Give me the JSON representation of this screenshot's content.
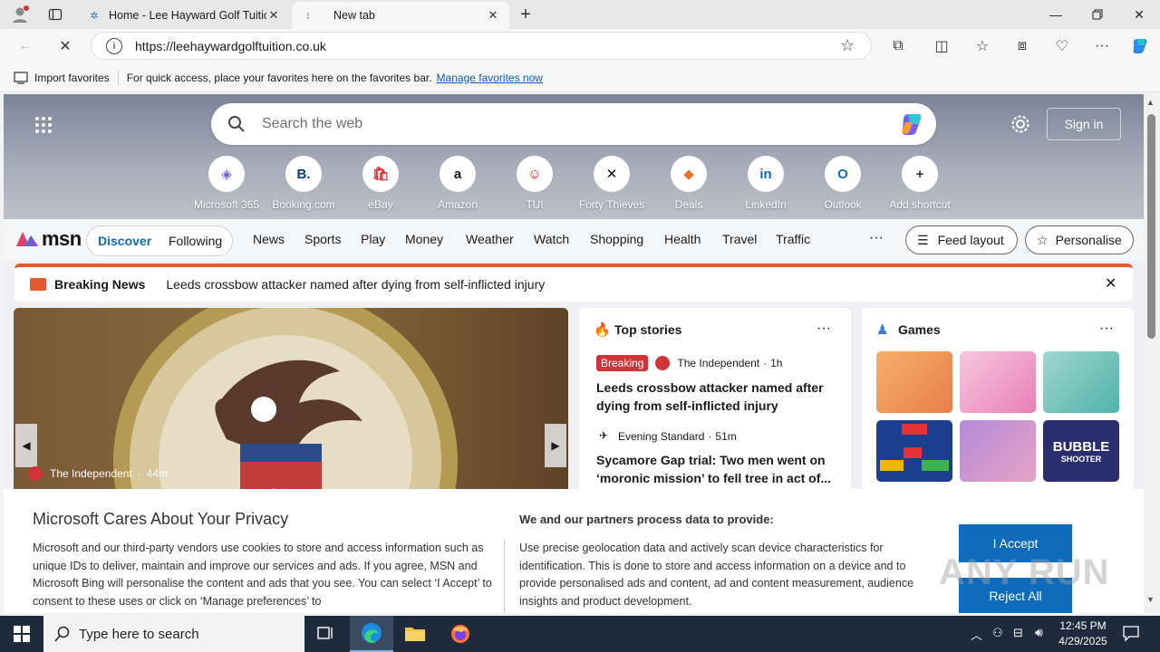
{
  "tabs": [
    {
      "title": "Home - Lee Hayward Golf Tuition"
    },
    {
      "title": "New tab"
    }
  ],
  "address": {
    "url": "https://leehaywardgolftuition.co.uk"
  },
  "favorites_bar": {
    "import_label": "Import favorites",
    "hint": "For quick access, place your favorites here on the favorites bar.",
    "manage_link": "Manage favorites now"
  },
  "msn": {
    "search_placeholder": "Search the web",
    "sign_in": "Sign in",
    "shortcuts": [
      {
        "label": "Microsoft 365",
        "glyph": "◈",
        "color": "#7a5cf0"
      },
      {
        "label": "Booking.com",
        "glyph": "B.",
        "color": "#0a3a82"
      },
      {
        "label": "eBay",
        "glyph": "🛍",
        "color": "#e53238"
      },
      {
        "label": "Amazon",
        "glyph": "a",
        "color": "#111111"
      },
      {
        "label": "TUI",
        "glyph": "☺",
        "color": "#d40e14"
      },
      {
        "label": "Forty Thieves",
        "glyph": "✕",
        "color": "#111111"
      },
      {
        "label": "Deals",
        "glyph": "◆",
        "color": "#e8742c"
      },
      {
        "label": "LinkedIn",
        "glyph": "in",
        "color": "#0a66c2"
      },
      {
        "label": "Outlook",
        "glyph": "O",
        "color": "#0f6cbd"
      },
      {
        "label": "Add shortcut",
        "glyph": "+",
        "color": "#333333"
      }
    ],
    "brand": "msn",
    "feed_tabs": {
      "discover": "Discover",
      "following": "Following"
    },
    "nav": [
      "News",
      "Sports",
      "Play",
      "Money",
      "Weather",
      "Watch",
      "Shopping",
      "Health",
      "Travel",
      "Traffic"
    ],
    "more": "···",
    "feed_layout": "Feed layout",
    "personalise": "Personalise",
    "breaking": {
      "label": "Breaking News",
      "headline": "Leeds crossbow attacker named after dying from self-inflicted injury"
    },
    "lead_story": {
      "source": "The Independent",
      "age": "44m"
    },
    "top_stories": {
      "title": "Top stories",
      "items": [
        {
          "badge": "Breaking",
          "source": "The Independent",
          "age": "1h",
          "headline": "Leeds crossbow attacker named after dying from self-inflicted injury"
        },
        {
          "badge": "",
          "source": "Evening Standard",
          "age": "51m",
          "headline": "Sycamore Gap trial: Two men went on ‘moronic mission’ to fell tree in act of..."
        }
      ]
    },
    "games": {
      "title": "Games",
      "bubble_label": "BUBBLE",
      "bubble_sub": "SHOOTER"
    }
  },
  "privacy": {
    "title": "Microsoft Cares About Your Privacy",
    "body": "Microsoft and our third-party vendors use cookies to store and access information such as unique IDs to deliver, maintain and improve our services and ads. If you agree, MSN and Microsoft Bing will personalise the content and ads that you see. You can select ‘I Accept’ to consent to these uses or click on ‘Manage preferences’ to",
    "right_title": "We and our partners process data to provide:",
    "right_body": "Use precise geolocation data and actively scan device characteristics for identification. This is done to store and access information on a device and to provide personalised ads and content, ad and content measurement, audience insights and product development.",
    "accept": "I Accept",
    "reject": "Reject All"
  },
  "watermark": "ANY RUN",
  "taskbar": {
    "search_placeholder": "Type here to search",
    "time": "12:45 PM",
    "date": "4/29/2025"
  },
  "colors": {
    "accent": "#0f6cbd",
    "breaking": "#e05a2f",
    "badge_red": "#d13438",
    "taskbar": "#1f2a3c"
  }
}
